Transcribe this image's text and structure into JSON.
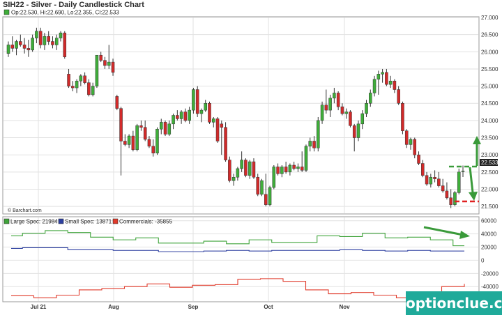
{
  "title": "SIH22 - Silver - Daily Candlestick Chart",
  "ohlc_label": "Op:22.530, Hi:22.690, Lo:22.355, Cl:22.533",
  "last_price_label": "22.533",
  "credit": "© Barchart.com",
  "watermark": "optionclue.com",
  "colors": {
    "up_candle": "#3fae3a",
    "down_candle": "#d22a2a",
    "large_spec": "#3fa33a",
    "small_spec": "#2c3fa0",
    "commercials": "#e03a2a",
    "arrow": "#3a9a3a",
    "support_dash": "#e02020",
    "grid": "#e2e2e2"
  },
  "chart_data": [
    {
      "type": "candlestick",
      "title": "SIH22 - Silver - Daily Candlestick Chart",
      "x_labels": [
        "Jul 21",
        "Aug",
        "Sep",
        "Oct",
        "Nov"
      ],
      "y_ticks": [
        "27.000",
        "26.500",
        "26.000",
        "25.500",
        "25.000",
        "24.500",
        "24.000",
        "23.500",
        "23.000",
        "22.500",
        "22.000",
        "21.500"
      ],
      "ylim": [
        21.3,
        27.0
      ],
      "candles": [
        {
          "o": 25.95,
          "h": 26.3,
          "l": 25.85,
          "c": 26.2
        },
        {
          "o": 26.2,
          "h": 26.45,
          "l": 26.0,
          "c": 26.1
        },
        {
          "o": 26.1,
          "h": 26.35,
          "l": 25.9,
          "c": 26.3
        },
        {
          "o": 26.3,
          "h": 26.5,
          "l": 26.15,
          "c": 26.2
        },
        {
          "o": 26.2,
          "h": 26.4,
          "l": 25.95,
          "c": 26.1
        },
        {
          "o": 26.1,
          "h": 26.35,
          "l": 25.85,
          "c": 26.05
        },
        {
          "o": 26.05,
          "h": 26.5,
          "l": 26.0,
          "c": 26.4
        },
        {
          "o": 26.4,
          "h": 26.7,
          "l": 26.25,
          "c": 26.6
        },
        {
          "o": 26.6,
          "h": 26.7,
          "l": 26.1,
          "c": 26.2
        },
        {
          "o": 26.2,
          "h": 26.55,
          "l": 26.05,
          "c": 26.45
        },
        {
          "o": 26.45,
          "h": 26.6,
          "l": 26.2,
          "c": 26.3
        },
        {
          "o": 26.3,
          "h": 26.45,
          "l": 26.1,
          "c": 26.2
        },
        {
          "o": 26.2,
          "h": 26.5,
          "l": 26.05,
          "c": 26.4
        },
        {
          "o": 26.4,
          "h": 26.6,
          "l": 26.3,
          "c": 26.55
        },
        {
          "o": 26.55,
          "h": 26.6,
          "l": 25.8,
          "c": 25.85
        },
        {
          "o": 25.35,
          "h": 25.5,
          "l": 24.95,
          "c": 25.0
        },
        {
          "o": 25.0,
          "h": 25.15,
          "l": 24.85,
          "c": 24.95
        },
        {
          "o": 24.95,
          "h": 25.2,
          "l": 24.8,
          "c": 25.15
        },
        {
          "o": 25.15,
          "h": 25.35,
          "l": 25.0,
          "c": 25.3
        },
        {
          "o": 25.3,
          "h": 25.4,
          "l": 25.05,
          "c": 25.1
        },
        {
          "o": 25.1,
          "h": 25.2,
          "l": 24.7,
          "c": 24.75
        },
        {
          "o": 24.75,
          "h": 25.1,
          "l": 24.7,
          "c": 25.0
        },
        {
          "o": 25.0,
          "h": 25.9,
          "l": 24.95,
          "c": 25.9
        },
        {
          "o": 25.9,
          "h": 26.0,
          "l": 25.7,
          "c": 25.75
        },
        {
          "o": 25.75,
          "h": 25.85,
          "l": 25.5,
          "c": 25.6
        },
        {
          "o": 25.6,
          "h": 26.2,
          "l": 25.5,
          "c": 25.7
        },
        {
          "o": 25.7,
          "h": 25.8,
          "l": 25.3,
          "c": 25.4
        },
        {
          "o": 24.7,
          "h": 24.75,
          "l": 24.3,
          "c": 24.35
        },
        {
          "o": 24.35,
          "h": 24.4,
          "l": 22.4,
          "c": 23.4
        },
        {
          "o": 23.4,
          "h": 23.6,
          "l": 23.25,
          "c": 23.3
        },
        {
          "o": 23.3,
          "h": 23.6,
          "l": 23.2,
          "c": 23.55
        },
        {
          "o": 23.55,
          "h": 23.7,
          "l": 23.1,
          "c": 23.15
        },
        {
          "o": 23.15,
          "h": 23.9,
          "l": 23.1,
          "c": 23.85
        },
        {
          "o": 23.85,
          "h": 24.0,
          "l": 23.7,
          "c": 23.8
        },
        {
          "o": 23.8,
          "h": 24.0,
          "l": 23.4,
          "c": 23.45
        },
        {
          "o": 23.45,
          "h": 23.55,
          "l": 23.2,
          "c": 23.25
        },
        {
          "o": 23.25,
          "h": 23.45,
          "l": 22.95,
          "c": 23.05
        },
        {
          "o": 23.05,
          "h": 23.8,
          "l": 23.0,
          "c": 23.75
        },
        {
          "o": 23.75,
          "h": 24.05,
          "l": 23.6,
          "c": 23.95
        },
        {
          "o": 23.95,
          "h": 24.0,
          "l": 23.55,
          "c": 23.6
        },
        {
          "o": 23.6,
          "h": 24.0,
          "l": 23.55,
          "c": 23.9
        },
        {
          "o": 23.9,
          "h": 24.2,
          "l": 23.75,
          "c": 24.15
        },
        {
          "o": 24.15,
          "h": 24.3,
          "l": 24.0,
          "c": 24.05
        },
        {
          "o": 24.05,
          "h": 24.3,
          "l": 23.9,
          "c": 24.25
        },
        {
          "o": 24.25,
          "h": 24.35,
          "l": 23.95,
          "c": 24.0
        },
        {
          "o": 24.0,
          "h": 24.4,
          "l": 23.9,
          "c": 24.3
        },
        {
          "o": 24.3,
          "h": 24.95,
          "l": 24.2,
          "c": 24.9
        },
        {
          "o": 24.9,
          "h": 25.0,
          "l": 24.1,
          "c": 24.2
        },
        {
          "o": 24.2,
          "h": 24.35,
          "l": 23.95,
          "c": 24.3
        },
        {
          "o": 24.3,
          "h": 24.6,
          "l": 24.25,
          "c": 24.5
        },
        {
          "o": 24.5,
          "h": 24.55,
          "l": 23.9,
          "c": 23.95
        },
        {
          "o": 23.95,
          "h": 24.1,
          "l": 23.8,
          "c": 24.05
        },
        {
          "o": 24.05,
          "h": 24.1,
          "l": 23.35,
          "c": 23.4
        },
        {
          "o": 23.9,
          "h": 24.0,
          "l": 23.0,
          "c": 23.8
        },
        {
          "o": 23.8,
          "h": 23.95,
          "l": 22.8,
          "c": 22.85
        },
        {
          "o": 22.85,
          "h": 22.95,
          "l": 22.2,
          "c": 22.25
        },
        {
          "o": 22.25,
          "h": 22.45,
          "l": 22.1,
          "c": 22.35
        },
        {
          "o": 22.35,
          "h": 22.65,
          "l": 22.25,
          "c": 22.6
        },
        {
          "o": 22.6,
          "h": 23.1,
          "l": 22.5,
          "c": 22.85
        },
        {
          "o": 22.85,
          "h": 22.9,
          "l": 22.35,
          "c": 22.4
        },
        {
          "o": 22.4,
          "h": 22.85,
          "l": 22.3,
          "c": 22.8
        },
        {
          "o": 22.8,
          "h": 22.9,
          "l": 22.3,
          "c": 22.35
        },
        {
          "o": 22.35,
          "h": 22.45,
          "l": 21.8,
          "c": 21.85
        },
        {
          "o": 21.85,
          "h": 22.3,
          "l": 21.8,
          "c": 22.25
        },
        {
          "o": 21.85,
          "h": 22.45,
          "l": 21.5,
          "c": 21.55
        },
        {
          "o": 21.55,
          "h": 22.1,
          "l": 21.5,
          "c": 22.05
        },
        {
          "o": 22.05,
          "h": 22.7,
          "l": 22.0,
          "c": 22.65
        },
        {
          "o": 22.65,
          "h": 22.75,
          "l": 22.4,
          "c": 22.45
        },
        {
          "o": 22.45,
          "h": 22.7,
          "l": 22.35,
          "c": 22.65
        },
        {
          "o": 22.65,
          "h": 22.8,
          "l": 22.45,
          "c": 22.5
        },
        {
          "o": 22.5,
          "h": 22.75,
          "l": 22.4,
          "c": 22.7
        },
        {
          "o": 22.7,
          "h": 22.8,
          "l": 22.55,
          "c": 22.6
        },
        {
          "o": 22.6,
          "h": 22.75,
          "l": 22.5,
          "c": 22.65
        },
        {
          "o": 22.65,
          "h": 23.1,
          "l": 22.5,
          "c": 22.55
        },
        {
          "o": 22.55,
          "h": 23.3,
          "l": 22.5,
          "c": 23.25
        },
        {
          "o": 23.25,
          "h": 23.5,
          "l": 23.1,
          "c": 23.4
        },
        {
          "o": 23.4,
          "h": 23.55,
          "l": 23.1,
          "c": 23.2
        },
        {
          "o": 23.2,
          "h": 24.1,
          "l": 23.1,
          "c": 24.0
        },
        {
          "o": 24.0,
          "h": 24.55,
          "l": 23.9,
          "c": 24.45
        },
        {
          "o": 24.45,
          "h": 24.9,
          "l": 24.2,
          "c": 24.3
        },
        {
          "o": 24.3,
          "h": 24.75,
          "l": 24.1,
          "c": 24.65
        },
        {
          "o": 24.65,
          "h": 24.95,
          "l": 24.5,
          "c": 24.8
        },
        {
          "o": 24.8,
          "h": 24.85,
          "l": 24.3,
          "c": 24.4
        },
        {
          "o": 24.4,
          "h": 24.5,
          "l": 24.15,
          "c": 24.2
        },
        {
          "o": 24.2,
          "h": 24.35,
          "l": 24.05,
          "c": 24.25
        },
        {
          "o": 24.25,
          "h": 24.3,
          "l": 23.8,
          "c": 23.85
        },
        {
          "o": 23.85,
          "h": 23.9,
          "l": 23.1,
          "c": 23.5
        },
        {
          "o": 23.5,
          "h": 24.0,
          "l": 23.4,
          "c": 23.9
        },
        {
          "o": 23.9,
          "h": 24.3,
          "l": 23.75,
          "c": 24.2
        },
        {
          "o": 24.2,
          "h": 24.6,
          "l": 24.1,
          "c": 24.5
        },
        {
          "o": 24.5,
          "h": 24.9,
          "l": 24.4,
          "c": 24.8
        },
        {
          "o": 24.8,
          "h": 25.3,
          "l": 24.7,
          "c": 25.2
        },
        {
          "o": 25.2,
          "h": 25.45,
          "l": 24.75,
          "c": 25.35
        },
        {
          "o": 25.35,
          "h": 25.5,
          "l": 25.1,
          "c": 25.4
        },
        {
          "o": 25.4,
          "h": 25.5,
          "l": 25.0,
          "c": 25.05
        },
        {
          "o": 25.05,
          "h": 25.3,
          "l": 24.95,
          "c": 25.15
        },
        {
          "o": 25.15,
          "h": 25.2,
          "l": 24.8,
          "c": 24.9
        },
        {
          "o": 24.9,
          "h": 25.0,
          "l": 24.45,
          "c": 24.5
        },
        {
          "o": 24.5,
          "h": 24.55,
          "l": 23.6,
          "c": 23.7
        },
        {
          "o": 23.7,
          "h": 23.75,
          "l": 23.2,
          "c": 23.3
        },
        {
          "o": 23.3,
          "h": 23.5,
          "l": 23.15,
          "c": 23.45
        },
        {
          "o": 23.45,
          "h": 23.5,
          "l": 22.9,
          "c": 23.0
        },
        {
          "o": 23.0,
          "h": 23.1,
          "l": 22.7,
          "c": 22.75
        },
        {
          "o": 22.75,
          "h": 22.85,
          "l": 22.35,
          "c": 22.4
        },
        {
          "o": 22.4,
          "h": 22.5,
          "l": 22.1,
          "c": 22.15
        },
        {
          "o": 22.15,
          "h": 22.45,
          "l": 22.05,
          "c": 22.35
        },
        {
          "o": 22.35,
          "h": 22.55,
          "l": 22.2,
          "c": 22.3
        },
        {
          "o": 22.3,
          "h": 22.5,
          "l": 22.05,
          "c": 22.1
        },
        {
          "o": 22.1,
          "h": 22.3,
          "l": 21.9,
          "c": 21.95
        },
        {
          "o": 21.95,
          "h": 22.2,
          "l": 21.7,
          "c": 21.75
        },
        {
          "o": 21.75,
          "h": 22.0,
          "l": 21.45,
          "c": 21.55
        },
        {
          "o": 21.55,
          "h": 21.95,
          "l": 21.5,
          "c": 21.9
        },
        {
          "o": 21.9,
          "h": 22.6,
          "l": 21.85,
          "c": 22.5
        },
        {
          "o": 22.53,
          "h": 22.69,
          "l": 22.355,
          "c": 22.533
        }
      ]
    },
    {
      "type": "line",
      "title": "",
      "y_ticks": [
        "60000",
        "40000",
        "20000",
        "0",
        "-20000",
        "-40000"
      ],
      "ylim": [
        -62000,
        65000
      ],
      "series": [
        {
          "name": "Large Spec: 21984",
          "values": [
            37000,
            41000,
            41000,
            45000,
            45000,
            42000,
            42000,
            35000,
            35000,
            31000,
            31000,
            34000,
            34000,
            26000,
            26000,
            26000,
            26000,
            29000,
            29000,
            25000,
            25000,
            31000,
            31000,
            27000,
            27000,
            27000,
            27000,
            37000,
            37000,
            36000,
            36000,
            41000,
            41000,
            34000,
            34000,
            35000,
            35000,
            31000,
            31000,
            22000,
            22000
          ]
        },
        {
          "name": "Small Spec: 13871",
          "values": [
            18000,
            19000,
            19000,
            19000,
            19000,
            16000,
            16000,
            16000,
            16000,
            15000,
            15000,
            15000,
            15000,
            13000,
            13000,
            13000,
            13000,
            14000,
            14000,
            15000,
            15000,
            14000,
            14000,
            15000,
            15000,
            15000,
            15000,
            15000,
            15000,
            16000,
            16000,
            15000,
            15000,
            14000,
            14000,
            15000,
            15000,
            14000,
            14000,
            14000,
            14000
          ]
        },
        {
          "name": "Commercials: -35855",
          "values": [
            -54000,
            -54000,
            -57000,
            -57000,
            -53000,
            -53000,
            -45000,
            -45000,
            -43000,
            -43000,
            -40000,
            -40000,
            -36000,
            -36000,
            -41000,
            -41000,
            -38000,
            -38000,
            -37000,
            -37000,
            -29000,
            -29000,
            -28000,
            -28000,
            -32000,
            -32000,
            -45000,
            -45000,
            -51000,
            -51000,
            -49000,
            -49000,
            -53000,
            -53000,
            -57000,
            -57000,
            -49000,
            -49000,
            -40000,
            -40000,
            -36000
          ]
        }
      ]
    }
  ]
}
